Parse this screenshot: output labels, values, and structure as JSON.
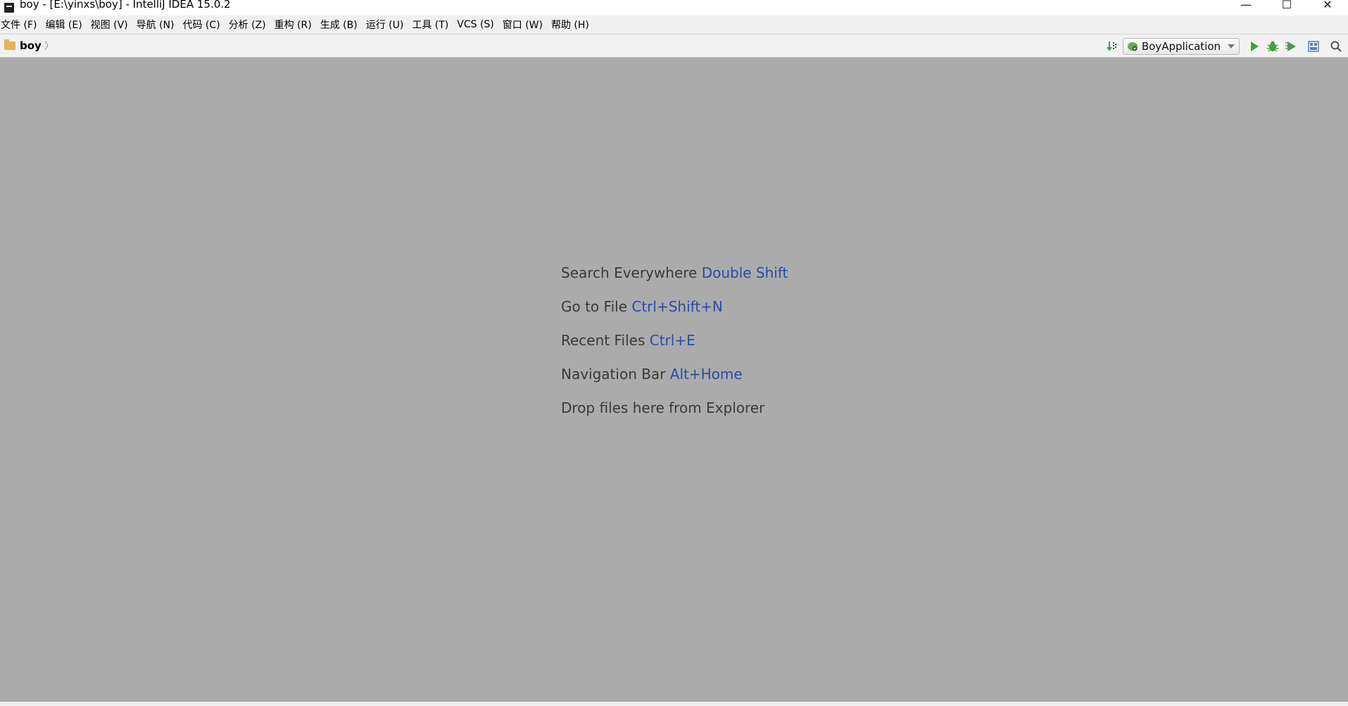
{
  "window": {
    "title": "boy - [E:\\yinxs\\boy] - IntelliJ IDEA 15.0.2",
    "controls": {
      "minimize": "—",
      "maximize": "☐",
      "close": "✕"
    }
  },
  "menu": {
    "items": [
      "文件 (F)",
      "编辑 (E)",
      "视图 (V)",
      "导航 (N)",
      "代码 (C)",
      "分析 (Z)",
      "重构 (R)",
      "生成 (B)",
      "运行 (U)",
      "工具 (T)",
      "VCS (S)",
      "窗口 (W)",
      "帮助 (H)"
    ]
  },
  "navbar": {
    "breadcrumb": "boy",
    "separator": "〉",
    "run_config": "BoyApplication"
  },
  "editor": {
    "hints": [
      {
        "label": "Search Everywhere ",
        "shortcut": "Double Shift"
      },
      {
        "label": "Go to File ",
        "shortcut": "Ctrl+Shift+N"
      },
      {
        "label": "Recent Files ",
        "shortcut": "Ctrl+E"
      },
      {
        "label": "Navigation Bar ",
        "shortcut": "Alt+Home"
      },
      {
        "label": "Drop files here from Explorer",
        "shortcut": ""
      }
    ]
  },
  "colors": {
    "editor_background": "#ababab",
    "shortcut_text": "#2c4aa8",
    "hint_text": "#3a3a3a",
    "run_green": "#3aa33a"
  }
}
